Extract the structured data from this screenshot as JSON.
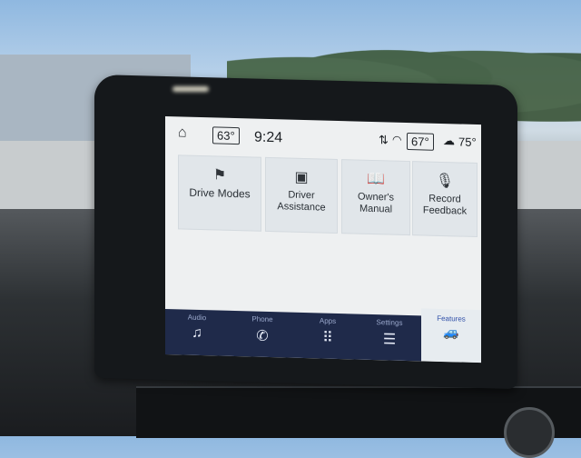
{
  "status_bar": {
    "home_icon": "home-icon",
    "outside_temp_left": "63°",
    "time": "9:24",
    "arrows_icon": "transfer-arrows-icon",
    "wifi_icon": "wifi-icon",
    "cabin_temp": "67°",
    "weather_icon": "partly-cloudy-icon",
    "outside_temp_right": "75°"
  },
  "tiles": [
    {
      "label": "Drive Modes",
      "icon": "drive-modes-icon"
    },
    {
      "label": "Driver\nAssistance",
      "icon": "driver-assistance-icon"
    },
    {
      "label": "Owner's Manual",
      "icon": "book-icon"
    },
    {
      "label": "Record\nFeedback",
      "icon": "microphone-icon"
    }
  ],
  "nav": {
    "audio": "Audio",
    "phone": "Phone",
    "apps": "Apps",
    "settings": "Settings",
    "features": "Features"
  }
}
